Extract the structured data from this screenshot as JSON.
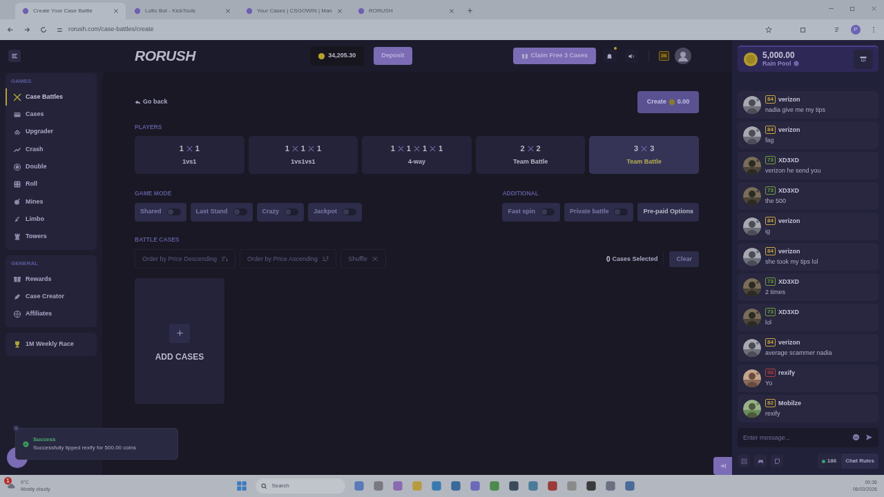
{
  "browser": {
    "tabs": [
      {
        "title": "Create Your Case Battle",
        "selected": true
      },
      {
        "title": "Lotto Bot - KickTools",
        "selected": false
      },
      {
        "title": "Your Cases | CSGOWIN | Man",
        "selected": false
      },
      {
        "title": "RORUSH",
        "selected": false
      }
    ],
    "url": "rorush.com/case-battles/create",
    "profile": "P"
  },
  "header": {
    "logo": "RORUSH",
    "balance": "34,205.30",
    "deposit": "Deposit",
    "claim": "Claim Free 3 Cases",
    "level": "36"
  },
  "sidebar": {
    "sections": [
      {
        "title": "GAMES",
        "items": [
          {
            "label": "Case Battles",
            "selected": true
          },
          {
            "label": "Cases",
            "selected": false
          },
          {
            "label": "Upgrader",
            "selected": false
          },
          {
            "label": "Crash",
            "selected": false
          },
          {
            "label": "Double",
            "selected": false
          },
          {
            "label": "Roll",
            "selected": false
          },
          {
            "label": "Mines",
            "selected": false
          },
          {
            "label": "Limbo",
            "selected": false
          },
          {
            "label": "Towers",
            "selected": false
          }
        ]
      },
      {
        "title": "GENERAL",
        "items": [
          {
            "label": "Rewards",
            "selected": false
          },
          {
            "label": "Case Creator",
            "selected": false
          },
          {
            "label": "Affiliates",
            "selected": false
          }
        ]
      }
    ],
    "race": "1M Weekly Race"
  },
  "main": {
    "back": "Go back",
    "create": {
      "label": "Create",
      "amount": "0.00"
    },
    "players_title": "PLAYERS",
    "player_modes": [
      {
        "counts": [
          "1",
          "1"
        ],
        "label": "1vs1",
        "selected": false
      },
      {
        "counts": [
          "1",
          "1",
          "1"
        ],
        "label": "1vs1vs1",
        "selected": false
      },
      {
        "counts": [
          "1",
          "1",
          "1",
          "1"
        ],
        "label": "4-way",
        "selected": false
      },
      {
        "counts": [
          "2",
          "2"
        ],
        "label": "Team Battle",
        "selected": false
      },
      {
        "counts": [
          "3",
          "3"
        ],
        "label": "Team Battle",
        "selected": true
      }
    ],
    "game_mode_title": "GAME MODE",
    "game_modes": [
      {
        "label": "Shared",
        "on": false
      },
      {
        "label": "Last Stand",
        "on": false
      },
      {
        "label": "Crazy",
        "on": false
      },
      {
        "label": "Jackpot",
        "on": false
      }
    ],
    "additional_title": "ADDITIONAL",
    "additional": [
      {
        "kind": "toggle",
        "label": "Fast spin",
        "on": false
      },
      {
        "kind": "toggle",
        "label": "Private battle",
        "on": false
      },
      {
        "kind": "button",
        "label": "Pre-paid Options"
      }
    ],
    "battle_cases_title": "BATTLE CASES",
    "sort_buttons": [
      "Order by Price Descending",
      "Order by Price Ascending",
      "Shuffle"
    ],
    "selected_count": "0",
    "selected_label": "Cases Selected",
    "clear": "Clear",
    "add_cases": "ADD CASES"
  },
  "toast": {
    "title": "Success",
    "message": "Successfully tipped rexify for 500.00 coins"
  },
  "chat": {
    "rain_amount": "5,000.00",
    "rain_label": "Rain Pool",
    "messages": [
      {
        "level": "84",
        "color": "#c9a640",
        "user": "verizon",
        "text": "nadia give me my tips"
      },
      {
        "level": "84",
        "color": "#c9a640",
        "user": "verizon",
        "text": "fag"
      },
      {
        "level": "73",
        "color": "#6f9e3c",
        "user": "XD3XD",
        "text": "verizon he send you"
      },
      {
        "level": "73",
        "color": "#6f9e3c",
        "user": "XD3XD",
        "text": "the 500"
      },
      {
        "level": "84",
        "color": "#c9a640",
        "user": "verizon",
        "text": "ig"
      },
      {
        "level": "84",
        "color": "#c9a640",
        "user": "verizon",
        "text": "she took my tips lol"
      },
      {
        "level": "73",
        "color": "#6f9e3c",
        "user": "XD3XD",
        "text": "2 times"
      },
      {
        "level": "73",
        "color": "#6f9e3c",
        "user": "XD3XD",
        "text": "lol"
      },
      {
        "level": "84",
        "color": "#c9a640",
        "user": "verizon",
        "text": "average scammer nadia"
      },
      {
        "level": "98",
        "color": "#b23b3b",
        "user": "rexify",
        "text": "Yo"
      },
      {
        "level": "82",
        "color": "#c9a640",
        "user": "Mobilze",
        "text": "rexify"
      }
    ],
    "placeholder": "Enter message...",
    "online": "186",
    "rules": "Chat Rules"
  },
  "taskbar": {
    "weather_badge": "1",
    "temperature": "9°C",
    "weather": "Mostly cloudy",
    "search": "Search",
    "time": "00:36",
    "date": "06/03/2026"
  }
}
